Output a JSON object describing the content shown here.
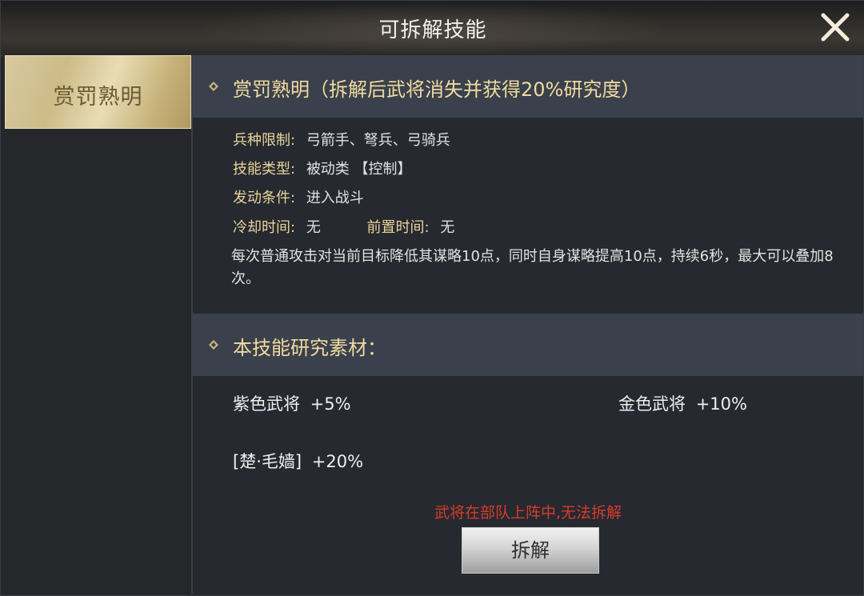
{
  "window": {
    "title": "可拆解技能"
  },
  "sidebar": {
    "items": [
      {
        "label": "赏罚熟明",
        "active": true
      }
    ]
  },
  "skill": {
    "header": "赏罚熟明（拆解后武将消失并获得20%研究度）",
    "troop_label": "兵种限制:",
    "troop_value": "弓箭手、弩兵、弓骑兵",
    "type_label": "技能类型:",
    "type_value": "被动类 【控制】",
    "trigger_label": "发动条件:",
    "trigger_value": "进入战斗",
    "cooldown_label": "冷却时间:",
    "cooldown_value": "无",
    "prep_label": "前置时间:",
    "prep_value": "无",
    "description": "每次普通攻击对当前目标降低其谋略10点，同时自身谋略提高10点，持续6秒，最大可以叠加8次。"
  },
  "materials": {
    "header": "本技能研究素材：",
    "items": [
      {
        "name": "紫色武将",
        "value": "+5%"
      },
      {
        "name": "金色武将",
        "value": "+10%"
      },
      {
        "name": "[楚·毛嫱]",
        "value": "+20%"
      }
    ]
  },
  "warning": "武将在部队上阵中,无法拆解",
  "action": {
    "disassemble_label": "拆解"
  },
  "colors": {
    "accent_gold": "#f0dba0",
    "warning_red": "#d63c2c",
    "header_bg": "#3a404c",
    "panel_bg": "#26292f"
  }
}
